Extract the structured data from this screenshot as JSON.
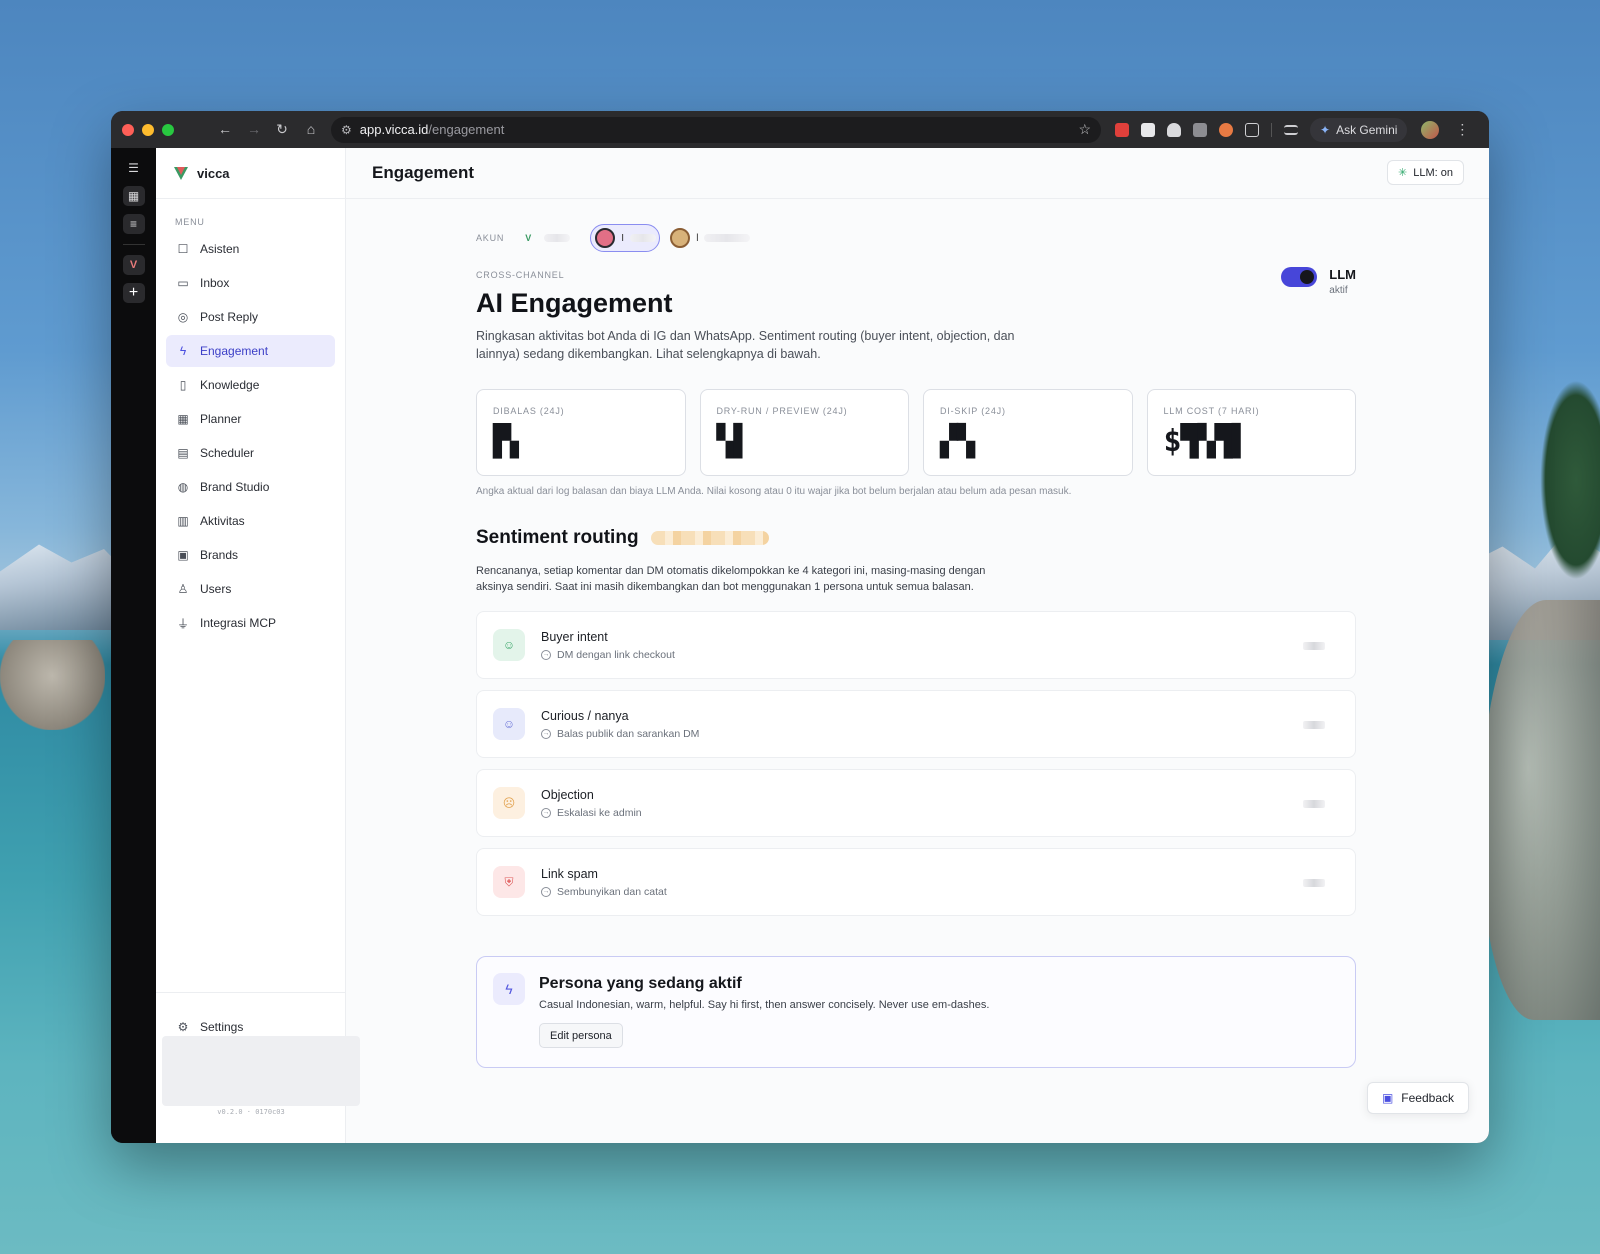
{
  "browser": {
    "url_host": "app.vicca.id",
    "url_path": "/engagement",
    "ask_gemini": "Ask Gemini"
  },
  "sidebar": {
    "brand": "vicca",
    "menu_label": "MENU",
    "items": [
      {
        "label": "Asisten",
        "icon": "bot-icon"
      },
      {
        "label": "Inbox",
        "icon": "inbox-icon"
      },
      {
        "label": "Post Reply",
        "icon": "instagram-icon"
      },
      {
        "label": "Engagement",
        "icon": "bolt-icon",
        "active": true
      },
      {
        "label": "Knowledge",
        "icon": "book-icon"
      },
      {
        "label": "Planner",
        "icon": "grid-icon"
      },
      {
        "label": "Scheduler",
        "icon": "calendar-icon"
      },
      {
        "label": "Brand Studio",
        "icon": "palette-icon"
      },
      {
        "label": "Aktivitas",
        "icon": "activity-icon"
      },
      {
        "label": "Brands",
        "icon": "building-icon"
      },
      {
        "label": "Users",
        "icon": "users-icon"
      },
      {
        "label": "Integrasi MCP",
        "icon": "plug-icon"
      }
    ],
    "settings": "Settings",
    "version": "v0.2.0 · 0170c03"
  },
  "header": {
    "title": "Engagement",
    "llm_pill": "LLM: on"
  },
  "accounts": {
    "label": "AKUN",
    "selected_text": "I",
    "third_text": "l"
  },
  "hero": {
    "eyebrow": "CROSS-CHANNEL",
    "title": "AI Engagement",
    "description": "Ringkasan aktivitas bot Anda di IG dan WhatsApp. Sentiment routing (buyer intent, objection, dan lainnya) sedang dikembangkan. Lihat selengkapnya di bawah.",
    "toggle_label": "LLM",
    "toggle_status": "aktif"
  },
  "stats": [
    {
      "label": "DIBALAS (24J)",
      "value": "▛▖"
    },
    {
      "label": "DRY-RUN / PREVIEW (24J)",
      "value": "▚▌"
    },
    {
      "label": "DI-SKIP (24J)",
      "value": "▞▚"
    },
    {
      "label": "LLM COST (7 HARI)",
      "value": "$▜▚▜▌"
    }
  ],
  "stats_note": "Angka aktual dari log balasan dan biaya LLM Anda. Nilai kosong atau 0 itu wajar jika bot belum berjalan atau belum ada pesan masuk.",
  "sentiment": {
    "title": "Sentiment routing",
    "description": "Rencananya, setiap komentar dan DM otomatis dikelompokkan ke 4 kategori ini, masing-masing dengan aksinya sendiri. Saat ini masih dikembangkan dan bot menggunakan 1 persona untuk semua balasan.",
    "routes": [
      {
        "name": "Buyer intent",
        "action": "DM dengan link checkout",
        "icon": "smile-icon",
        "color": "#3ea86d"
      },
      {
        "name": "Curious / nanya",
        "action": "Balas publik dan sarankan DM",
        "icon": "question-face-icon",
        "color": "#6b74d8"
      },
      {
        "name": "Objection",
        "action": "Eskalasi ke admin",
        "icon": "frown-icon",
        "color": "#e2a24f"
      },
      {
        "name": "Link spam",
        "action": "Sembunyikan dan catat",
        "icon": "shield-icon",
        "color": "#df5b5b"
      }
    ]
  },
  "persona": {
    "title": "Persona yang sedang aktif",
    "description": "Casual Indonesian, warm, helpful. Say hi first, then answer concisely. Never use em-dashes.",
    "button": "Edit persona"
  },
  "feedback": "Feedback"
}
